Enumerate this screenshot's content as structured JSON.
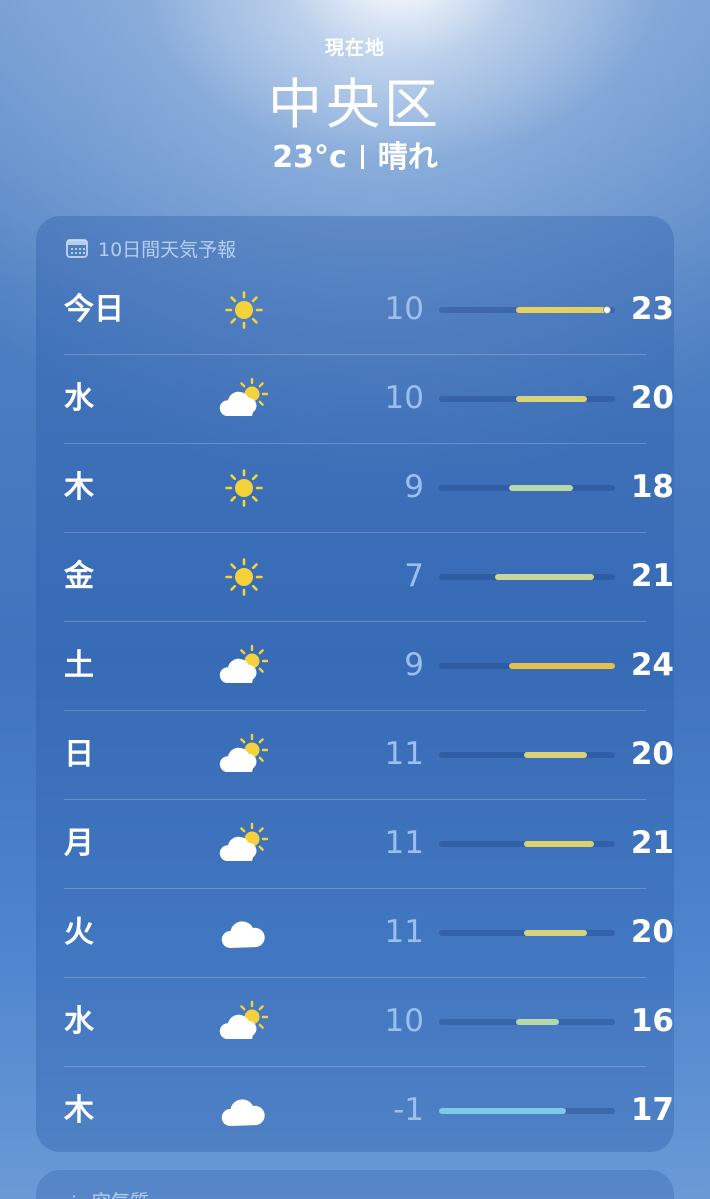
{
  "location": {
    "label": "現在地",
    "city": "中央区",
    "temp": "23°c",
    "condition": "晴れ"
  },
  "forecast": {
    "title": "10日間天気予報",
    "scale": {
      "min": -1,
      "max": 24
    },
    "days": [
      {
        "day": "今日",
        "icon": "sun-icon",
        "low": "10",
        "high": "23",
        "lowN": 10,
        "highN": 23,
        "current": 23,
        "color": "#e8d15a"
      },
      {
        "day": "水",
        "icon": "partly-cloudy-icon",
        "low": "10",
        "high": "20",
        "lowN": 10,
        "highN": 20,
        "color": "#d9d27a"
      },
      {
        "day": "木",
        "icon": "sun-icon",
        "low": "9",
        "high": "18",
        "lowN": 9,
        "highN": 18,
        "color": "#b8d8a8"
      },
      {
        "day": "金",
        "icon": "sun-icon",
        "low": "7",
        "high": "21",
        "lowN": 7,
        "highN": 21,
        "color": "#c9d59a"
      },
      {
        "day": "土",
        "icon": "partly-cloudy-icon",
        "low": "9",
        "high": "24",
        "lowN": 9,
        "highN": 24,
        "color": "#e6c04c"
      },
      {
        "day": "日",
        "icon": "partly-cloudy-icon",
        "low": "11",
        "high": "20",
        "lowN": 11,
        "highN": 20,
        "color": "#d9d27a"
      },
      {
        "day": "月",
        "icon": "partly-cloudy-icon",
        "low": "11",
        "high": "21",
        "lowN": 11,
        "highN": 21,
        "color": "#dcd26a"
      },
      {
        "day": "火",
        "icon": "cloud-icon",
        "low": "11",
        "high": "20",
        "lowN": 11,
        "highN": 20,
        "color": "#d9d27a"
      },
      {
        "day": "水",
        "icon": "partly-cloudy-icon",
        "low": "10",
        "high": "16",
        "lowN": 10,
        "highN": 16,
        "color": "#b5d8a8"
      },
      {
        "day": "木",
        "icon": "cloud-icon",
        "low": "-1",
        "high": "17",
        "lowN": -1,
        "highN": 17,
        "color": "#7fcbe6"
      }
    ]
  },
  "next_card": {
    "title": "空気質"
  }
}
